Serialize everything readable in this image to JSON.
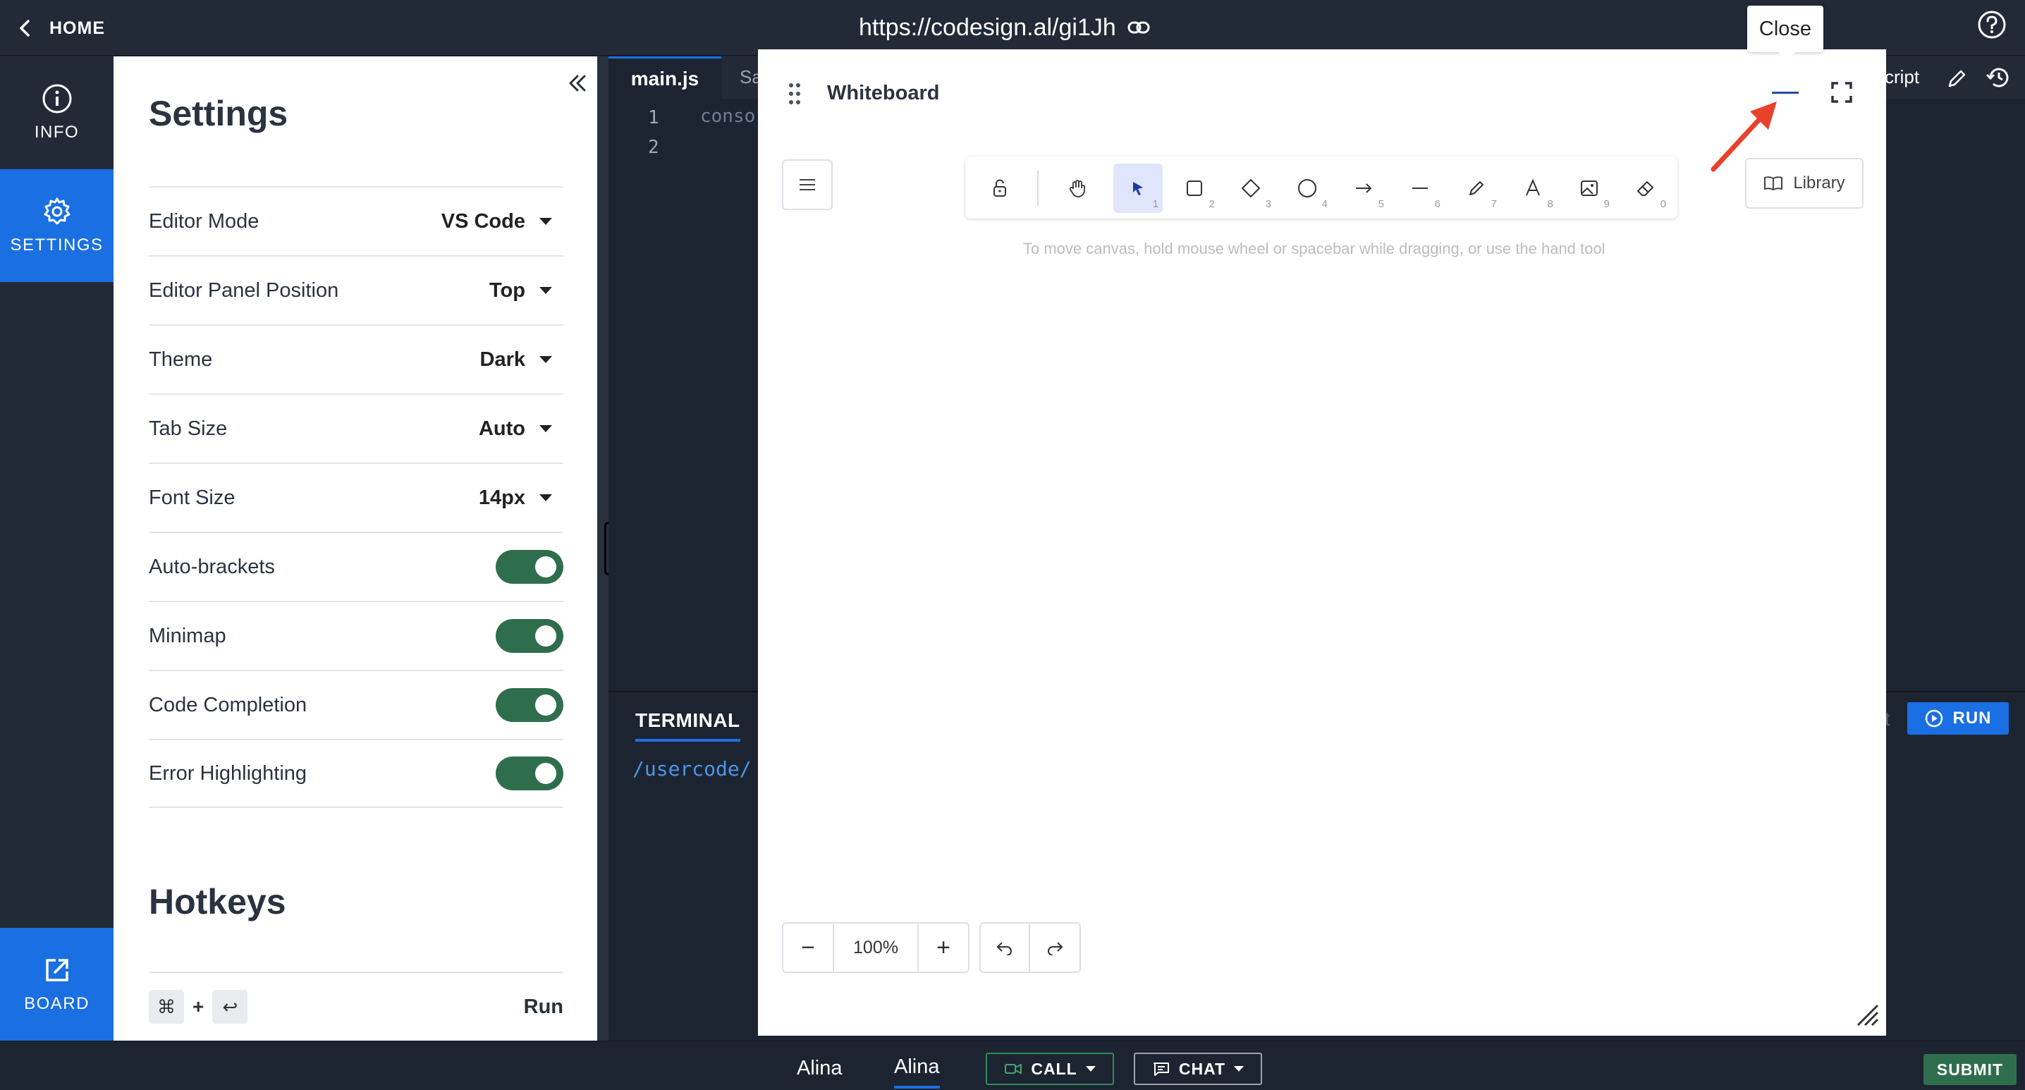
{
  "topbar": {
    "home_label": "HOME",
    "url": "https://codesign.al/gi1Jh"
  },
  "rail": {
    "info_label": "INFO",
    "settings_label": "SETTINGS",
    "board_label": "BOARD"
  },
  "settings": {
    "title": "Settings",
    "rows": [
      {
        "label": "Editor Mode",
        "value": "VS Code",
        "type": "select"
      },
      {
        "label": "Editor Panel Position",
        "value": "Top",
        "type": "select"
      },
      {
        "label": "Theme",
        "value": "Dark",
        "type": "select"
      },
      {
        "label": "Tab Size",
        "value": "Auto",
        "type": "select"
      },
      {
        "label": "Font Size",
        "value": "14px",
        "type": "select"
      },
      {
        "label": "Auto-brackets",
        "value": "on",
        "type": "toggle"
      },
      {
        "label": "Minimap",
        "value": "on",
        "type": "toggle"
      },
      {
        "label": "Code Completion",
        "value": "on",
        "type": "toggle"
      },
      {
        "label": "Error Highlighting",
        "value": "on",
        "type": "toggle"
      }
    ],
    "hotkeys_title": "Hotkeys",
    "hotkey": {
      "key1": "⌘",
      "plus": "+",
      "key2": "↩",
      "action": "Run"
    }
  },
  "editor": {
    "tabs": [
      "main.js",
      "Sa"
    ],
    "right_tab": "cript",
    "lines": [
      "1",
      "2"
    ],
    "code_line": "conso",
    "terminal_label": "TERMINAL",
    "terminal_path": "/usercode/",
    "terminal_partial": "t",
    "run_label": "RUN"
  },
  "whiteboard": {
    "title": "Whiteboard",
    "tooltip": "Close",
    "library_label": "Library",
    "hint": "To move canvas, hold mouse wheel or spacebar while dragging, or use the hand tool",
    "zoom": "100%",
    "zoom_out": "−",
    "zoom_in": "+",
    "tools": [
      {
        "icon": "lock-icon",
        "num": ""
      },
      {
        "icon": "hand-icon",
        "num": ""
      },
      {
        "icon": "selection-icon",
        "num": "1",
        "active": true
      },
      {
        "icon": "rectangle-icon",
        "num": "2"
      },
      {
        "icon": "diamond-icon",
        "num": "3"
      },
      {
        "icon": "ellipse-icon",
        "num": "4"
      },
      {
        "icon": "arrow-icon",
        "num": "5"
      },
      {
        "icon": "line-icon",
        "num": "6"
      },
      {
        "icon": "pencil-icon",
        "num": "7"
      },
      {
        "icon": "text-icon",
        "num": "8"
      },
      {
        "icon": "image-icon",
        "num": "9"
      },
      {
        "icon": "eraser-icon",
        "num": "0"
      }
    ]
  },
  "bottom": {
    "user1": "Alina",
    "user2": "Alina",
    "call_label": "CALL",
    "chat_label": "CHAT",
    "submit_label": "SUBMIT"
  },
  "colors": {
    "accent": "#1a6fe2",
    "toggle_on": "#2f6e4d",
    "annotation_arrow": "#e8412c"
  }
}
